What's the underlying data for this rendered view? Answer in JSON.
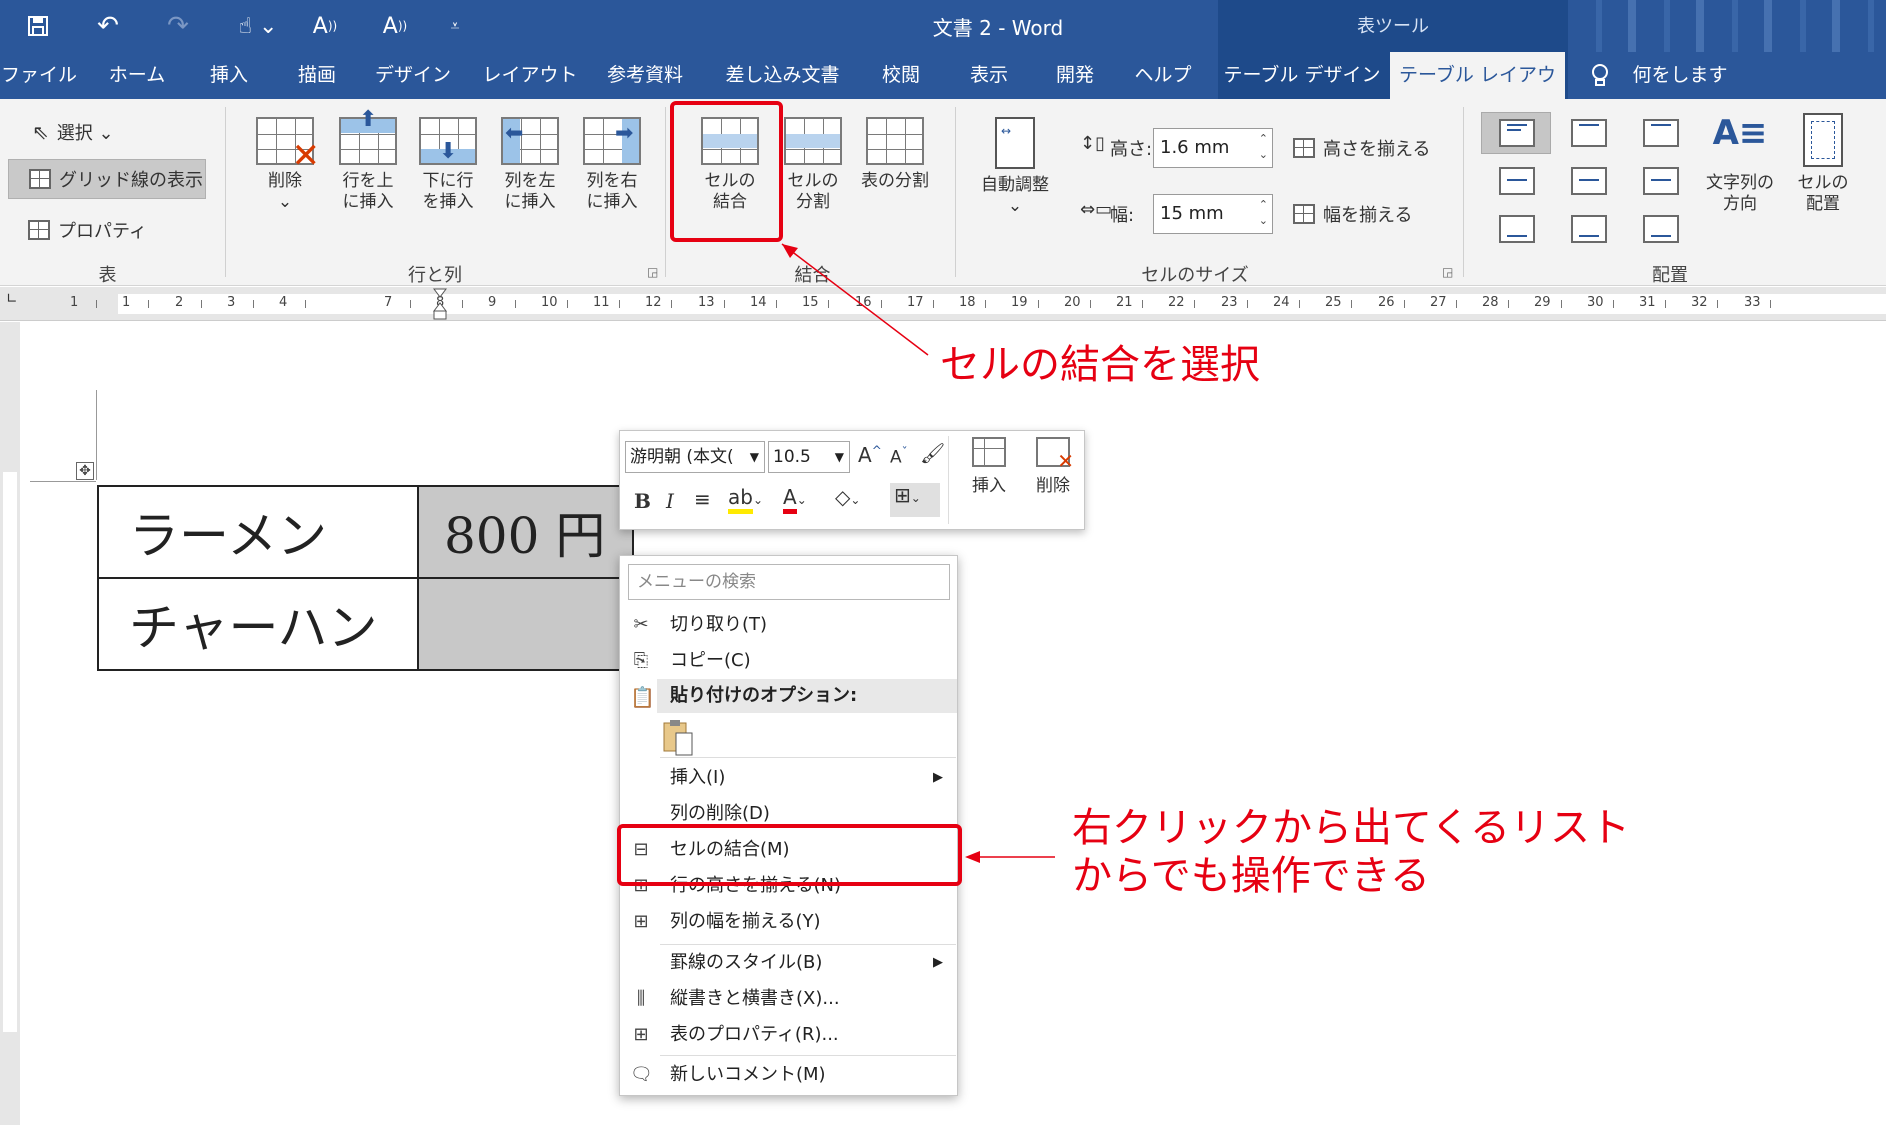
{
  "titlebar": {
    "doc_title": "文書 2  -  Word",
    "context_label": "表ツール",
    "qa_icons": [
      "save-icon",
      "undo-icon",
      "redo-icon",
      "touch-mode-icon",
      "read-aloud-icon",
      "read-aloud-icon-2",
      "customize-icon"
    ]
  },
  "tabs": [
    "ファイル",
    "ホーム",
    "挿入",
    "描画",
    "デザイン",
    "レイアウト",
    "参考資料",
    "差し込み文書",
    "校閲",
    "表示",
    "開発",
    "ヘルプ",
    "テーブル デザイン",
    "テーブル レイアウト",
    "何をしますか"
  ],
  "ribbon": {
    "table_group": {
      "select": "選択 ⌄",
      "gridlines": "グリッド線の表示",
      "properties": "プロパティ",
      "label": "表"
    },
    "rows_cols_group": {
      "delete": "削除",
      "delete_arrow": "⌄",
      "insert_above_1": "行を上",
      "insert_above_2": "に挿入",
      "insert_below_1": "下に行",
      "insert_below_2": "を挿入",
      "insert_left_1": "列を左",
      "insert_left_2": "に挿入",
      "insert_right_1": "列を右",
      "insert_right_2": "に挿入",
      "label": "行と列"
    },
    "merge_group": {
      "merge_1": "セルの",
      "merge_2": "結合",
      "split_1": "セルの",
      "split_2": "分割",
      "split_table": "表の分割",
      "label": "結合"
    },
    "cellsize_group": {
      "autofit": "自動調整",
      "autofit_arrow": "⌄",
      "height_label": "高さ:",
      "height_value": "1.6 mm",
      "width_label": "幅:",
      "width_value": "15 mm",
      "distribute_rows": "高さを揃える",
      "distribute_cols": "幅を揃える",
      "label": "セルのサイズ"
    },
    "alignment_group": {
      "text_direction_1": "文字列の",
      "text_direction_2": "方向",
      "cell_margins_1": "セルの",
      "cell_margins_2": "配置",
      "label": "配置"
    }
  },
  "ruler": {
    "numbers": [
      "1",
      "1",
      "2",
      "3",
      "4",
      "7",
      "8",
      "9",
      "10",
      "11",
      "12",
      "13",
      "14",
      "15",
      "16",
      "17",
      "18",
      "19",
      "20",
      "21",
      "22",
      "23",
      "24",
      "25",
      "26",
      "27",
      "28",
      "29",
      "30",
      "31",
      "32",
      "33"
    ]
  },
  "document": {
    "rows": [
      {
        "col1": "ラーメン",
        "col2": "800 円"
      },
      {
        "col1": "チャーハン",
        "col2": ""
      }
    ]
  },
  "minitoolbar": {
    "font": "游明朝 (本文(",
    "size": "10.5",
    "grow": "A",
    "shrink": "A",
    "bold": "B",
    "italic": "I",
    "font_color": "A",
    "insert": "挿入",
    "delete": "削除"
  },
  "contextmenu": {
    "search_placeholder": "メニューの検索",
    "items": [
      "切り取り(T)",
      "コピー(C)",
      "貼り付けのオプション:",
      "挿入(I)",
      "列の削除(D)",
      "セルの結合(M)",
      "行の高さを揃える(N)",
      "列の幅を揃える(Y)",
      "罫線のスタイル(B)",
      "縦書きと横書き(X)...",
      "表のプロパティ(R)...",
      "新しいコメント(M)"
    ]
  },
  "annotations": {
    "ribbon_note": "セルの結合を選択",
    "menu_note_1": "右クリックから出てくるリスト",
    "menu_note_2": "からでも操作できる",
    "color": "#e60012"
  },
  "colors": {
    "brand": "#2b579a",
    "annotation": "#e60012"
  }
}
